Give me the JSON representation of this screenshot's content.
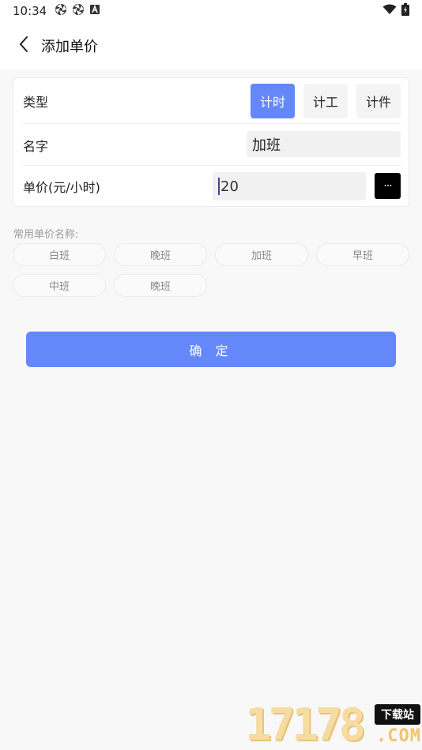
{
  "status_bar": {
    "time": "10:34",
    "left_icons": [
      "aperture-icon",
      "aperture-icon",
      "android-icon"
    ],
    "right_icons": [
      "wifi-icon",
      "battery-icon"
    ]
  },
  "app_bar": {
    "title": "添加单价",
    "back_icon": "chevron-left-icon"
  },
  "form": {
    "type": {
      "label": "类型",
      "options": [
        "计时",
        "计工",
        "计件"
      ],
      "selected": "计时"
    },
    "name": {
      "label": "名字",
      "value": "加班"
    },
    "price": {
      "label": "单价(元/小时)",
      "value": "20",
      "more_label": "···"
    }
  },
  "common_names": {
    "label": "常用单价名称:",
    "chips": [
      "白班",
      "晚班",
      "加班",
      "早班",
      "中班",
      "晚班"
    ]
  },
  "confirm_label": "确 定",
  "watermark": {
    "number": "17178",
    "tag": "下载站",
    "com": ".COM"
  },
  "colors": {
    "accent": "#6488fa",
    "background": "#f8f8f8",
    "card": "#ffffff"
  }
}
